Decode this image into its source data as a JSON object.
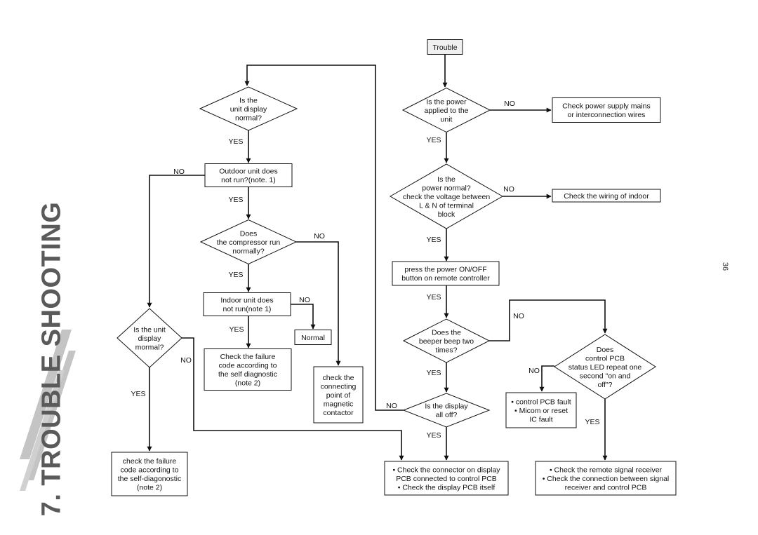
{
  "page": {
    "section_title": "7. TROUBLE SHOOTING",
    "page_number": "36"
  },
  "nodes": {
    "trouble": {
      "type": "start",
      "lines": [
        "Trouble"
      ]
    },
    "power_applied": {
      "type": "decision",
      "lines": [
        "Is the power",
        "applied to the",
        "unit"
      ]
    },
    "check_power_supply": {
      "type": "process",
      "lines": [
        "Check power supply mains",
        "or interconnection wires"
      ]
    },
    "power_normal": {
      "type": "decision",
      "lines": [
        "Is the",
        "power normal?",
        "check the voltage between",
        "L & N of terminal",
        "block"
      ]
    },
    "check_wiring": {
      "type": "process",
      "lines": [
        "Check the wiring of indoor"
      ]
    },
    "press_onoff": {
      "type": "process",
      "lines": [
        "press the power ON/OFF",
        "button on remote controller"
      ]
    },
    "beeper": {
      "type": "decision",
      "lines": [
        "Does the",
        "beeper beep two",
        "times?"
      ]
    },
    "display_all_off": {
      "type": "decision",
      "lines": [
        "Is the display",
        "all off?"
      ]
    },
    "check_connector": {
      "type": "process",
      "lines": [
        "• Check the connector on display",
        "PCB connected to control PCB",
        "• Check the display PCB itself"
      ]
    },
    "pcb_led": {
      "type": "decision",
      "lines": [
        "Does",
        "control PCB",
        "status LED repeat one",
        "second \"on and",
        "off\"?"
      ]
    },
    "pcb_fault": {
      "type": "process",
      "lines": [
        "• control PCB fault",
        "• Micom or reset",
        "IC fault"
      ]
    },
    "check_remote": {
      "type": "process",
      "lines": [
        "• Check the remote signal receiver",
        "• Check the connection between signal",
        "receiver and control PCB"
      ]
    },
    "unit_display_normal": {
      "type": "decision",
      "lines": [
        "Is the",
        "unit display",
        "normal?"
      ]
    },
    "outdoor_not_run": {
      "type": "process",
      "lines": [
        "Outdoor unit does",
        "not run?(note. 1)"
      ]
    },
    "compressor": {
      "type": "decision",
      "lines": [
        "Does",
        "the compressor run",
        "normally?"
      ]
    },
    "indoor_not_run": {
      "type": "process",
      "lines": [
        "Indoor unit does",
        "not run(note 1)"
      ]
    },
    "normal": {
      "type": "process",
      "lines": [
        "Normal"
      ]
    },
    "check_failure_code": {
      "type": "process",
      "lines": [
        "Check the failure",
        "code according to",
        "the self diagnostic",
        "(note  2)"
      ]
    },
    "check_magnetic": {
      "type": "process",
      "lines": [
        "check the",
        "connecting",
        "point of",
        "magnetic",
        "contactor"
      ]
    },
    "unit_display_mormal": {
      "type": "decision",
      "lines": [
        "Is the unit",
        "display",
        "mormal?"
      ]
    },
    "check_failure_code_2": {
      "type": "process",
      "lines": [
        "check the failure",
        "code according to",
        "the self-diagonostic",
        "(note 2)"
      ]
    }
  },
  "edge_labels": {
    "power_applied_no": "NO",
    "power_applied_yes": "YES",
    "power_normal_no": "NO",
    "power_normal_yes": "YES",
    "press_onoff_yes": "YES",
    "beeper_no": "NO",
    "beeper_yes": "YES",
    "display_all_off_no": "NO",
    "display_all_off_yes": "YES",
    "pcb_led_no": "NO",
    "pcb_led_yes": "YES",
    "unit_display_yes": "YES",
    "outdoor_no": "NO",
    "outdoor_yes": "YES",
    "compressor_no": "NO",
    "compressor_yes": "YES",
    "indoor_no": "NO",
    "indoor_yes": "YES",
    "mormal_no": "NO",
    "mormal_yes": "YES"
  },
  "colors": {
    "line": "#111111",
    "start_fill": "#f0f0f0",
    "section_title": "#5a5a5a",
    "stripes": "#bdbdbd"
  }
}
